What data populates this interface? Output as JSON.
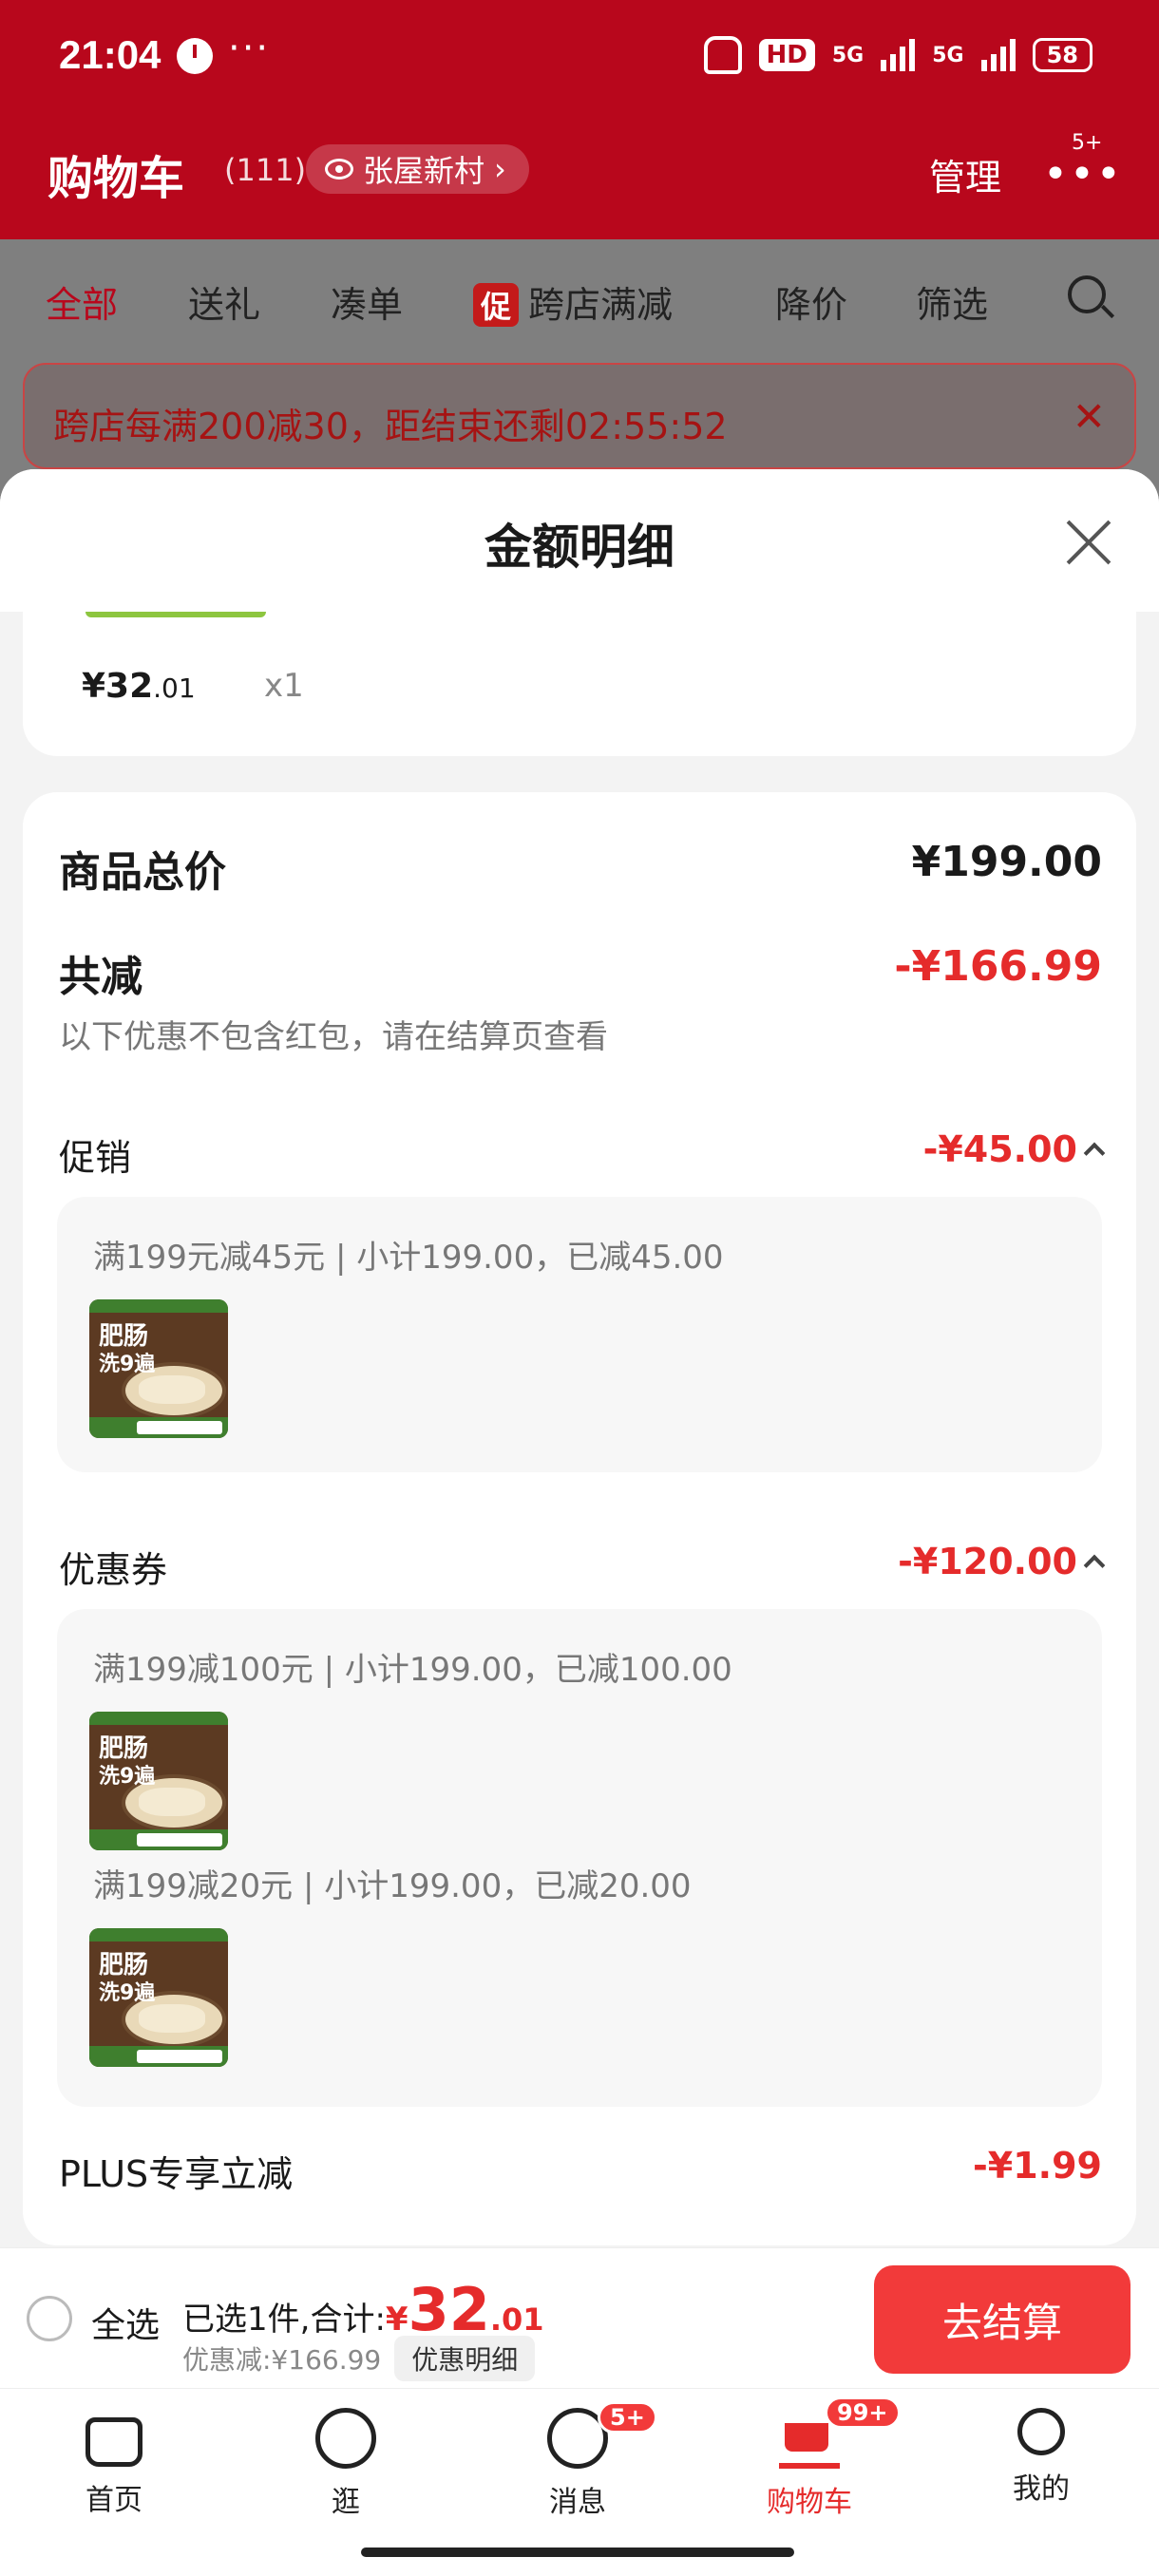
{
  "status_bar": {
    "time": "21:04",
    "dots": "···",
    "hd": "HD",
    "net1": "5G",
    "net2": "5G",
    "battery": "58"
  },
  "header": {
    "title": "购物车",
    "count": "(111)",
    "location": "张屋新村",
    "location_chevron": "›",
    "manage": "管理",
    "more_badge": "5+"
  },
  "filters": {
    "tabs": [
      "全部",
      "送礼",
      "凑单",
      "跨店满减",
      "降价",
      "筛选"
    ],
    "promo_chip": "促"
  },
  "notice": {
    "text": "跨店每满200减30，距结束还剩02:55:52",
    "close": "✕"
  },
  "sheet": {
    "title": "金额明细",
    "item": {
      "price_main": "¥32",
      "price_decimal": ".01",
      "qty": "x1"
    },
    "goods_total_label": "商品总价",
    "goods_total_value": "¥199.00",
    "total_discount_label": "共减",
    "total_discount_value": "-¥166.99",
    "note": "以下优惠不包含红包，请在结算页查看",
    "promotion": {
      "label": "促销",
      "value": "-¥45.00",
      "lines": [
        "满199元减45元 | 小计199.00，已减45.00"
      ]
    },
    "coupon": {
      "label": "优惠券",
      "value": "-¥120.00",
      "lines": [
        "满199减100元 | 小计199.00，已减100.00",
        "满199减20元 | 小计199.00，已减20.00"
      ]
    },
    "plus": {
      "label": "PLUS专享立减",
      "value": "-¥1.99"
    },
    "thumb": {
      "text1": "肥肠",
      "text2": "洗9遍"
    }
  },
  "bottom_bar": {
    "select_all": "全选",
    "selected_prefix": "已选1件,合计:",
    "currency": "¥",
    "total_main": "32",
    "total_decimal": ".01",
    "discount_text": "优惠减:¥166.99",
    "detail_chip": "优惠明细",
    "checkout": "去结算"
  },
  "tab_bar": {
    "tabs": [
      {
        "label": "首页",
        "icon": "home-icon"
      },
      {
        "label": "逛",
        "icon": "browse-icon"
      },
      {
        "label": "消息",
        "icon": "message-icon",
        "badge": "5+"
      },
      {
        "label": "购物车",
        "icon": "cart-icon",
        "badge": "99+",
        "active": true
      },
      {
        "label": "我的",
        "icon": "profile-icon"
      }
    ]
  },
  "colors": {
    "brand_red": "#b8071c",
    "accent_red": "#e52b2b",
    "button_red": "#f23a3a"
  }
}
